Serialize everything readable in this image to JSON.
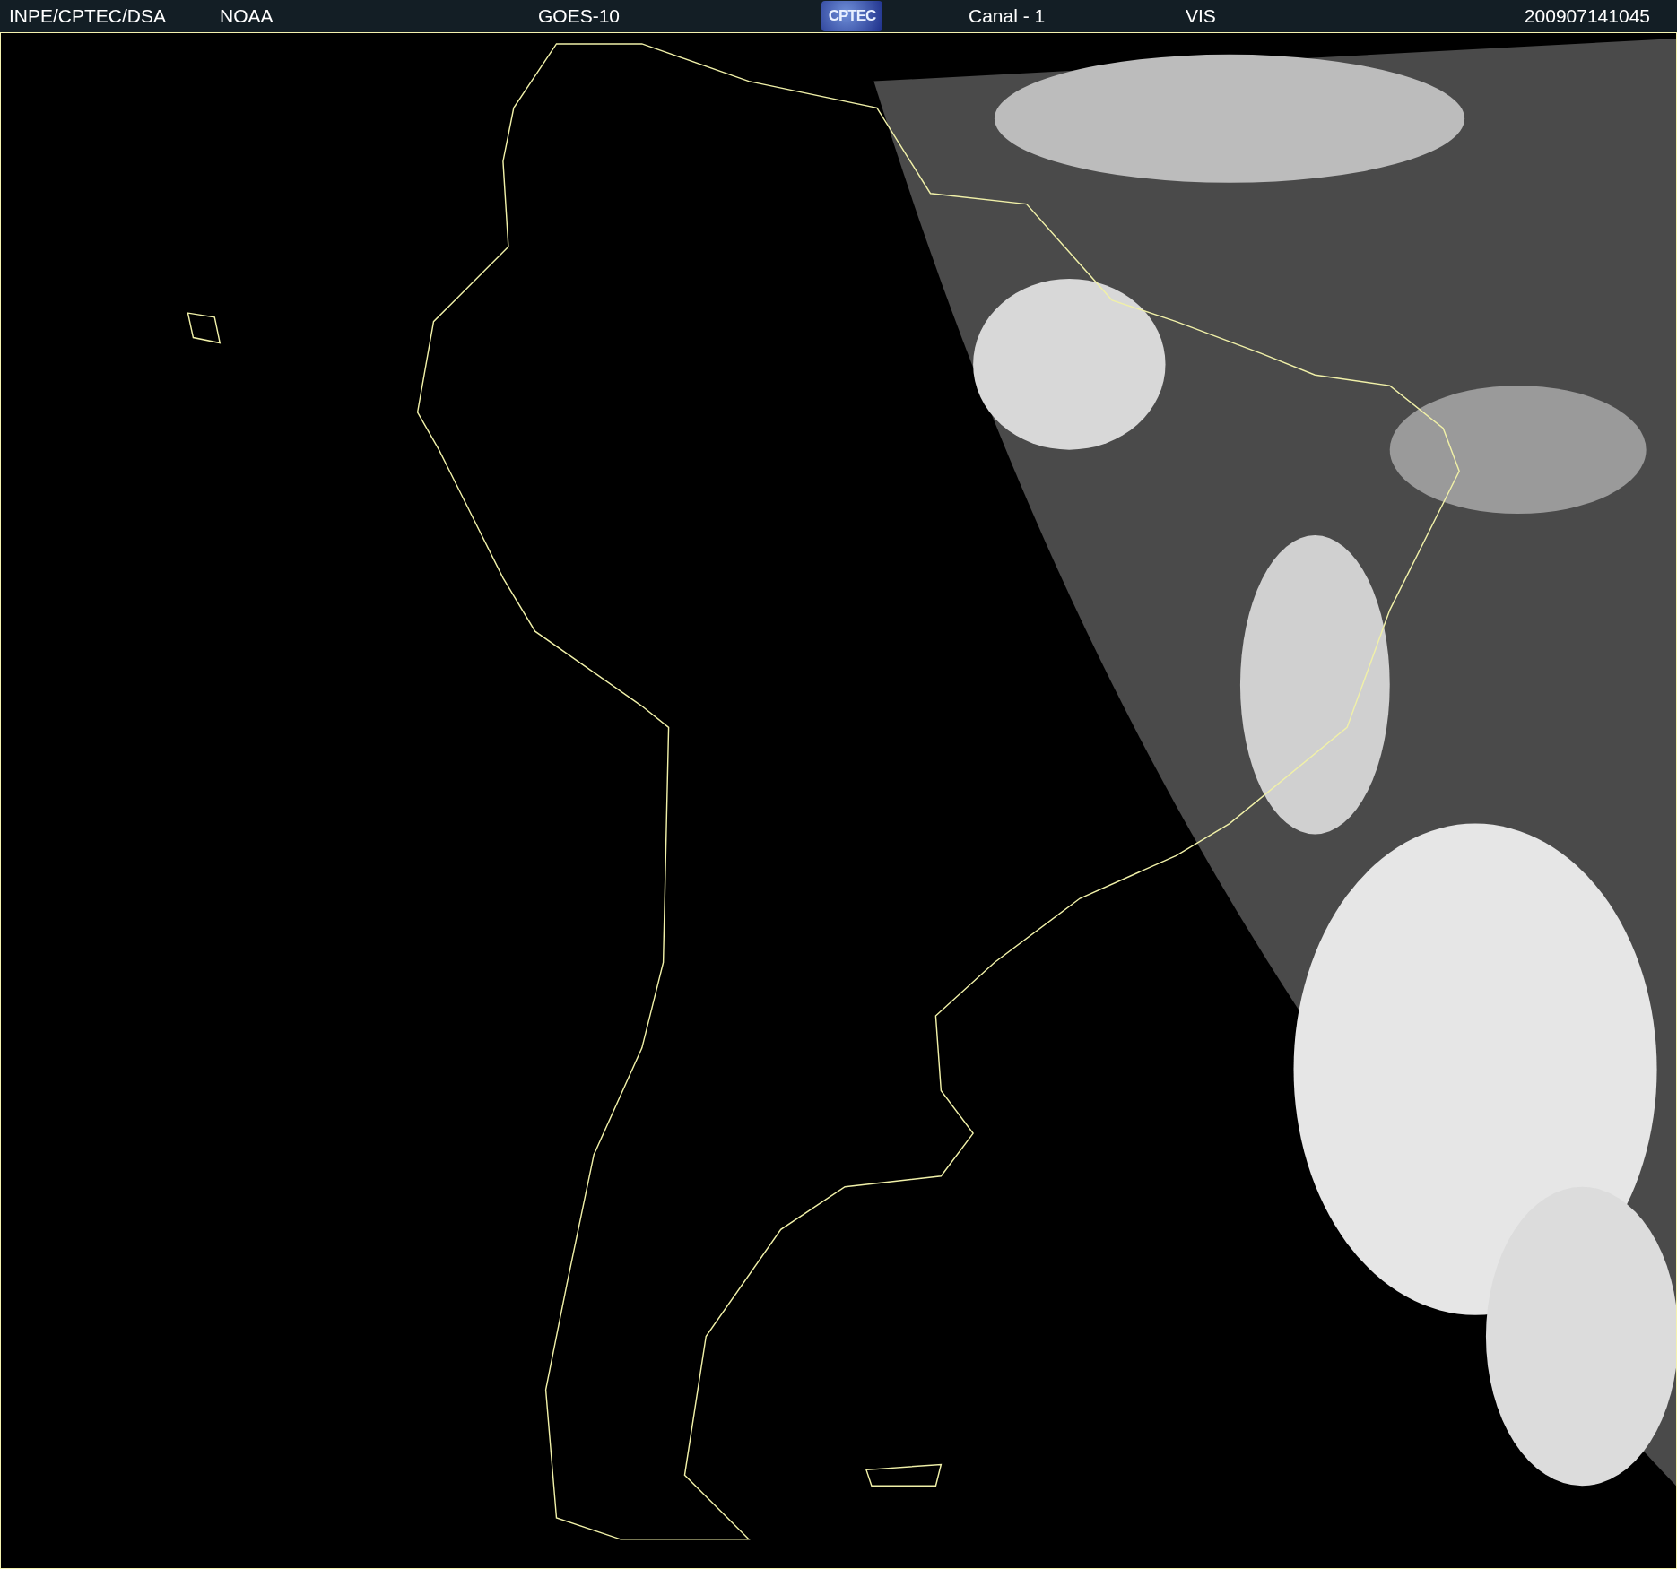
{
  "header": {
    "source": "INPE/CPTEC/DSA",
    "agency": "NOAA",
    "satellite": "GOES-10",
    "logo_text": "CPTEC",
    "channel": "Canal - 1",
    "band": "VIS",
    "timestamp": "200907141045"
  }
}
